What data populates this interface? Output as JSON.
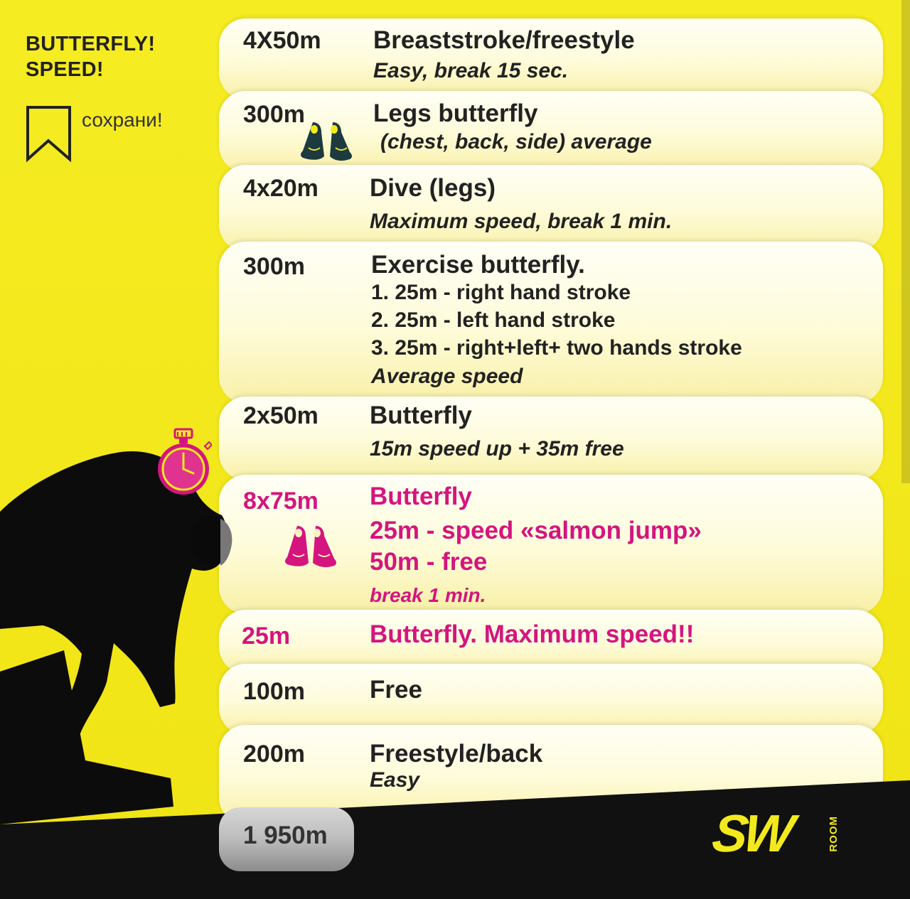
{
  "heading": {
    "line1": "BUTTERFLY!",
    "line2": "SPEED!"
  },
  "save": {
    "label": "сохрани!"
  },
  "rows": [
    {
      "distance": "4X50m",
      "main": "Breaststroke/freestyle",
      "sub": "Easy, break 15 sec."
    },
    {
      "distance": "300m",
      "main": "Legs butterfly",
      "sub": "(chest, back, side) average"
    },
    {
      "distance": "4x20m",
      "main": "Dive (legs)",
      "sub": "Maximum speed, break 1 min."
    },
    {
      "distance": "300m",
      "main": "Exercise butterfly.",
      "items": [
        "1. 25m - right hand stroke",
        "2. 25m - left hand stroke",
        "3. 25m - right+left+ two hands stroke"
      ],
      "sub": "Average speed"
    },
    {
      "distance": "2x50m",
      "main": "Butterfly",
      "sub": "15m speed up + 35m free"
    },
    {
      "distance": "8x75m",
      "main": "Butterfly",
      "items": [
        "25m - speed «salmon jump»",
        "50m - free"
      ],
      "sub": "break 1 min."
    },
    {
      "distance": "25m",
      "main": "Butterfly. Maximum speed!!"
    },
    {
      "distance": "100m",
      "main": "Free"
    },
    {
      "distance": "200m",
      "main": "Freestyle/back",
      "sub": "Easy"
    }
  ],
  "total": {
    "distance": "1 950m"
  },
  "logo": {
    "letters": "SW",
    "room": "ROOM"
  },
  "colors": {
    "background": "#f2ea1c",
    "accent_pink": "#d4157f",
    "fins_dark": "#1d3a3f",
    "text": "#222222"
  },
  "icons": [
    "bookmark-icon",
    "fins-icon",
    "stopwatch-icon"
  ]
}
